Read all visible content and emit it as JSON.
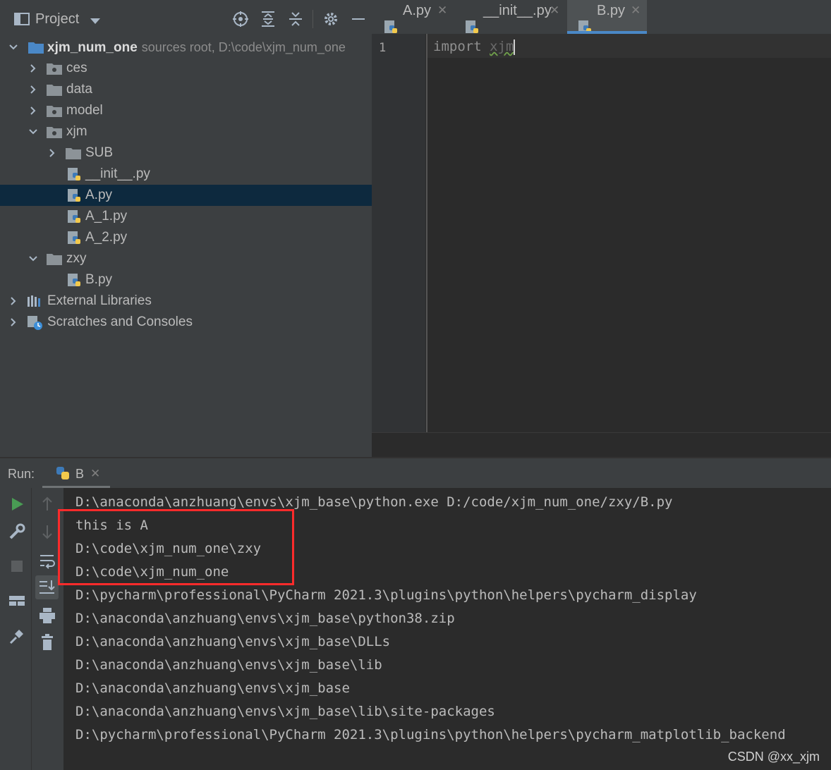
{
  "project": {
    "title": "Project",
    "tree": [
      {
        "name": "xjm_num_one",
        "hint": "sources root,  D:\\code\\xjm_num_one"
      },
      {
        "name": "ces"
      },
      {
        "name": "data"
      },
      {
        "name": "model"
      },
      {
        "name": "xjm"
      },
      {
        "name": "SUB"
      },
      {
        "name": "__init__.py"
      },
      {
        "name": "A.py"
      },
      {
        "name": "A_1.py"
      },
      {
        "name": "A_2.py"
      },
      {
        "name": "zxy"
      },
      {
        "name": "B.py"
      },
      {
        "name": "External Libraries"
      },
      {
        "name": "Scratches and Consoles"
      }
    ]
  },
  "editor": {
    "tabs": [
      {
        "label": "A.py"
      },
      {
        "label": "__init__.py"
      },
      {
        "label": "B.py"
      }
    ],
    "line_number": "1",
    "code_keyword": "import",
    "code_module": "xjm"
  },
  "run": {
    "label": "Run:",
    "tab_label": "B",
    "console": [
      "D:\\anaconda\\anzhuang\\envs\\xjm_base\\python.exe D:/code/xjm_num_one/zxy/B.py",
      "this is A",
      "D:\\code\\xjm_num_one\\zxy",
      "D:\\code\\xjm_num_one",
      "D:\\pycharm\\professional\\PyCharm 2021.3\\plugins\\python\\helpers\\pycharm_display",
      "D:\\anaconda\\anzhuang\\envs\\xjm_base\\python38.zip",
      "D:\\anaconda\\anzhuang\\envs\\xjm_base\\DLLs",
      "D:\\anaconda\\anzhuang\\envs\\xjm_base\\lib",
      "D:\\anaconda\\anzhuang\\envs\\xjm_base",
      "D:\\anaconda\\anzhuang\\envs\\xjm_base\\lib\\site-packages",
      "D:\\pycharm\\professional\\PyCharm 2021.3\\plugins\\python\\helpers\\pycharm_matplotlib_backend"
    ]
  },
  "watermark": "CSDN @xx_xjm",
  "colors": {
    "selection": "#0d293e",
    "tab_accent": "#4a88c7",
    "highlight_box": "#ff2b2b",
    "run_green": "#499c54"
  }
}
